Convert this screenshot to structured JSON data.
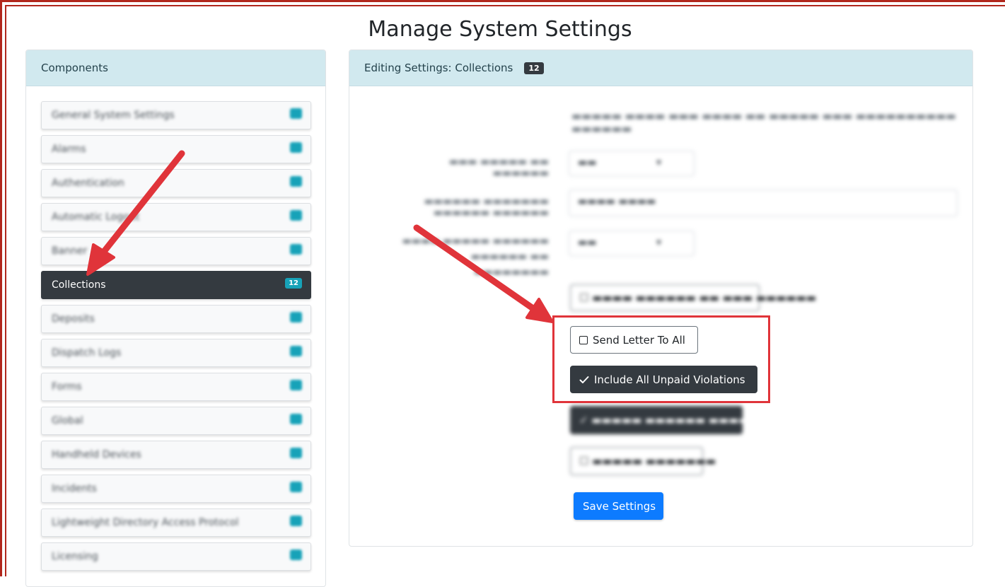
{
  "page": {
    "title": "Manage System Settings"
  },
  "sidebar": {
    "header": "Components",
    "items": [
      {
        "label": "General System Settings",
        "count": "",
        "active": false
      },
      {
        "label": "Alarms",
        "count": "",
        "active": false
      },
      {
        "label": "Authentication",
        "count": "",
        "active": false
      },
      {
        "label": "Automatic Logout",
        "count": "",
        "active": false
      },
      {
        "label": "Banner",
        "count": "",
        "active": false
      },
      {
        "label": "Collections",
        "count": "12",
        "active": true
      },
      {
        "label": "Deposits",
        "count": "",
        "active": false
      },
      {
        "label": "Dispatch Logs",
        "count": "",
        "active": false
      },
      {
        "label": "Forms",
        "count": "",
        "active": false
      },
      {
        "label": "Global",
        "count": "",
        "active": false
      },
      {
        "label": "Handheld Devices",
        "count": "",
        "active": false
      },
      {
        "label": "Incidents",
        "count": "",
        "active": false
      },
      {
        "label": "Lightweight Directory Access Protocol",
        "count": "",
        "active": false
      },
      {
        "label": "Licensing",
        "count": "",
        "active": false
      }
    ]
  },
  "editor": {
    "header_label": "Editing Settings: Collections",
    "header_badge": "12",
    "send_letter_label": "Send Letter To All",
    "include_unpaid_label": "Include All Unpaid Violations",
    "save_label": "Save Settings"
  },
  "icons": {
    "checkbox": "checkbox-icon",
    "checkmark": "checkmark-icon"
  },
  "colors": {
    "annotation_red": "#e0343a",
    "header_bg": "#d1e9ef",
    "active_item": "#343a40",
    "badge": "#17a2b8",
    "primary": "#0d7bff",
    "frame": "#b1271c"
  }
}
